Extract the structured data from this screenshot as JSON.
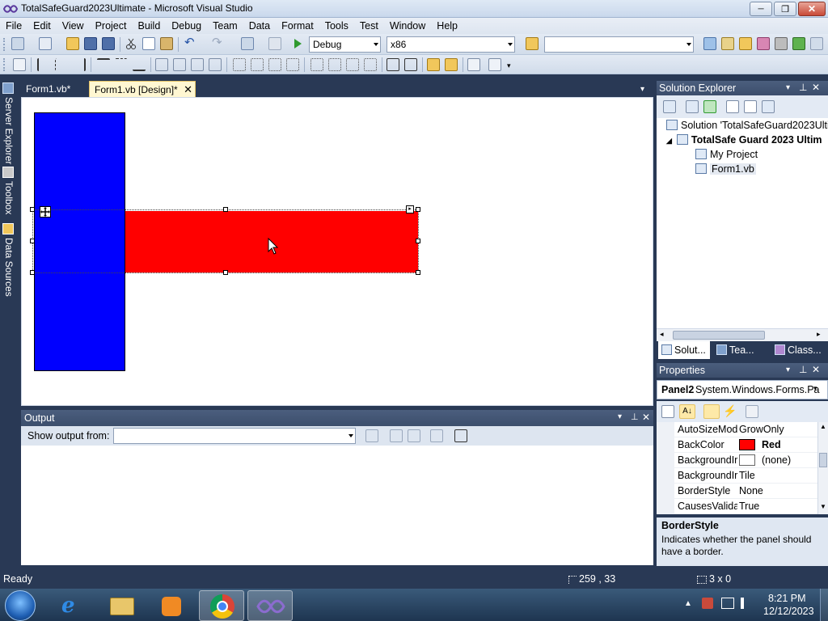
{
  "window": {
    "title": "TotalSafeGuard2023Ultimate - Microsoft Visual Studio",
    "minimize": "─",
    "maximize": "❐",
    "close": "✕"
  },
  "menu": [
    "File",
    "Edit",
    "View",
    "Project",
    "Build",
    "Debug",
    "Team",
    "Data",
    "Format",
    "Tools",
    "Test",
    "Window",
    "Help"
  ],
  "toolbar": {
    "configuration": "Debug",
    "platform": "x86",
    "find_combo": ""
  },
  "side_tabs": [
    "Server Explorer",
    "Toolbox",
    "Data Sources"
  ],
  "document_tabs": [
    {
      "label": "Form1.vb*",
      "active": false
    },
    {
      "label": "Form1.vb [Design]*",
      "active": true
    }
  ],
  "designer": {
    "panel_blue_color": "#0000ff",
    "panel_red_color": "#ff0000"
  },
  "output": {
    "title": "Output",
    "show_output_from_label": "Show output from:",
    "show_output_from_value": ""
  },
  "solution_explorer": {
    "title": "Solution Explorer",
    "tree": [
      {
        "label": "Solution 'TotalSafeGuard2023Ulti",
        "bold": false,
        "indent": 0
      },
      {
        "label": "TotalSafe Guard 2023 Ultim",
        "bold": true,
        "indent": 1
      },
      {
        "label": "My Project",
        "bold": false,
        "indent": 2
      },
      {
        "label": "Form1.vb",
        "bold": false,
        "indent": 2
      }
    ],
    "bottom_tabs": [
      "Solut...",
      "Tea...",
      "Class..."
    ]
  },
  "properties": {
    "title": "Properties",
    "object_name": "Panel2",
    "object_type": "System.Windows.Forms.Pa",
    "rows": [
      {
        "name": "AutoSizeMod",
        "value": "GrowOnly",
        "swatch": ""
      },
      {
        "name": "BackColor",
        "value": "Red",
        "swatch": "#ff0000"
      },
      {
        "name": "BackgroundIr",
        "value": "(none)",
        "swatch": "#ffffff"
      },
      {
        "name": "BackgroundIr",
        "value": "Tile",
        "swatch": ""
      },
      {
        "name": "BorderStyle",
        "value": "None",
        "swatch": ""
      },
      {
        "name": "CausesValidat",
        "value": "True",
        "swatch": ""
      }
    ],
    "description_title": "BorderStyle",
    "description_text": "Indicates whether the panel should have a border."
  },
  "status": {
    "text": "Ready",
    "position": "259 , 33",
    "size": "3 x 0"
  },
  "taskbar": {
    "time": "8:21 PM",
    "date": "12/12/2023",
    "apps": [
      "internet-explorer",
      "file-explorer",
      "media-player",
      "chrome",
      "visual-studio"
    ]
  }
}
